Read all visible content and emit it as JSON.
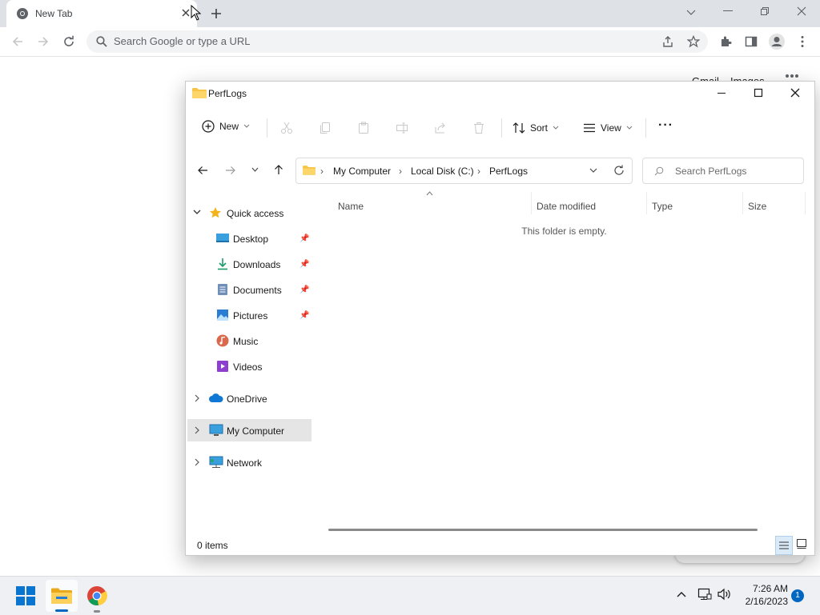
{
  "chrome": {
    "tab_title": "New Tab",
    "omnibox_placeholder": "Search Google or type a URL",
    "ntp_links": [
      "Gmail",
      "Images"
    ]
  },
  "explorer": {
    "title": "PerfLogs",
    "toolbar": {
      "new_label": "New",
      "sort_label": "Sort",
      "view_label": "View",
      "more_label": "···"
    },
    "breadcrumb": [
      "My Computer",
      "Local Disk (C:)",
      "PerfLogs"
    ],
    "search_placeholder": "Search PerfLogs",
    "nav": {
      "quick_access": "Quick access",
      "items": [
        "Desktop",
        "Downloads",
        "Documents",
        "Pictures",
        "Music",
        "Videos"
      ],
      "onedrive": "OneDrive",
      "my_computer": "My Computer",
      "network": "Network"
    },
    "columns": [
      "Name",
      "Date modified",
      "Type",
      "Size"
    ],
    "empty_message": "This folder is empty.",
    "status": "0 items"
  },
  "taskbar": {
    "time": "7:26 AM",
    "date": "2/16/2023",
    "notification_count": "1"
  },
  "colors": {
    "folder_yellow": "#f8c646",
    "selection_gray": "#e5e5e5",
    "accent_blue": "#0067c0"
  }
}
